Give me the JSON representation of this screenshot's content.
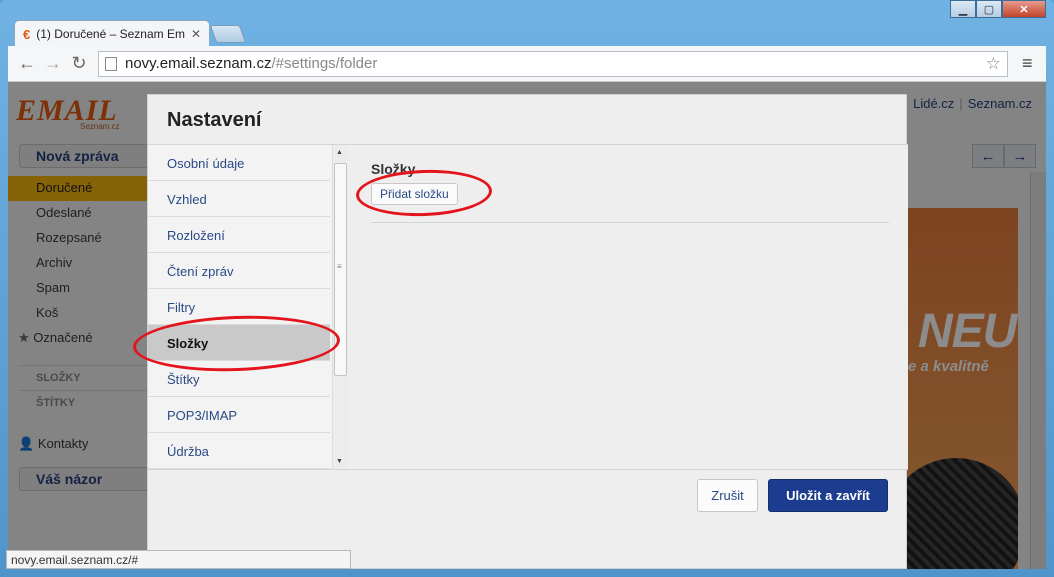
{
  "browser": {
    "tab_title": "(1) Doručené – Seznam Em",
    "url_host": "novy.email.seznam.cz",
    "url_path": "/#settings/folder",
    "status_url": "novy.email.seznam.cz/#"
  },
  "mail": {
    "logo": "EMAIL",
    "logo_sub": "Seznam.cz",
    "compose_label": "Nová zpráva",
    "folders": [
      "Doručené",
      "Odeslané",
      "Rozepsané",
      "Archiv",
      "Spam",
      "Koš"
    ],
    "starred_label": "Označené",
    "folders_heading": "SLOŽKY",
    "labels_heading": "ŠTÍTKY",
    "contacts_label": "Kontakty",
    "opinion_label": "Váš názor",
    "top_links": [
      "Lidé.cz",
      "Seznam.cz"
    ],
    "ad_word": "NEU",
    "ad_tag": "e a kvalitně"
  },
  "settings": {
    "title": "Nastavení",
    "nav": [
      "Osobní údaje",
      "Vzhled",
      "Rozložení",
      "Čtení zpráv",
      "Filtry",
      "Složky",
      "Štítky",
      "POP3/IMAP",
      "Údržba"
    ],
    "active_nav": "Složky",
    "section_title": "Složky",
    "add_folder_label": "Přidat složku",
    "cancel_label": "Zrušit",
    "save_label": "Uložit a zavřít"
  },
  "colors": {
    "accent": "#1c3d8f",
    "selected_folder": "#f5b50e",
    "annotation": "#e3141c"
  }
}
